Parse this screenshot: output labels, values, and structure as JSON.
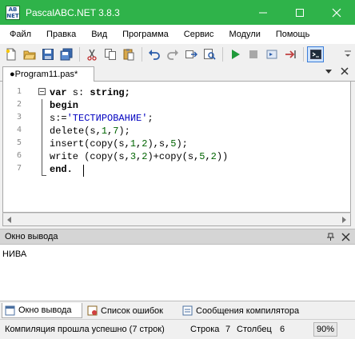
{
  "window": {
    "title": "PascalABC.NET 3.8.3",
    "icon_text": [
      "AB",
      "NET"
    ]
  },
  "menu": [
    "Файл",
    "Правка",
    "Вид",
    "Программа",
    "Сервис",
    "Модули",
    "Помощь"
  ],
  "toolbar": {
    "buttons": [
      "new-file-icon",
      "open-folder-icon",
      "save-icon",
      "save-all-icon",
      "cut-icon",
      "copy-icon",
      "paste-icon",
      "undo-icon",
      "redo-icon",
      "navigate-icon",
      "find-icon",
      "run-icon",
      "stop-icon",
      "step-icon",
      "debug-icon",
      "console-icon"
    ]
  },
  "editor": {
    "tab_label": "●Program11.pas*",
    "line_numbers": [
      "1",
      "2",
      "3",
      "4",
      "5",
      "6",
      "7"
    ],
    "lines": {
      "l1_kw": "var",
      "l1_rest": " s: ",
      "l1_type": "string;",
      "l2_kw": "begin",
      "l3_a": "s:=",
      "l3_str": "'ТЕСТИРОВАНИЕ'",
      "l3_b": ";",
      "l4_a": "delete(s,",
      "l4_n1": "1",
      "l4_b": ",",
      "l4_n2": "7",
      "l4_c": ");",
      "l5_a": "insert(copy(s,",
      "l5_n1": "1",
      "l5_b": ",",
      "l5_n2": "2",
      "l5_c": "),s,",
      "l5_n3": "5",
      "l5_d": ");",
      "l6_a": "write (copy(s,",
      "l6_n1": "3",
      "l6_b": ",",
      "l6_n2": "2",
      "l6_c": ")+copy(s,",
      "l6_n3": "5",
      "l6_d": ",",
      "l6_n4": "2",
      "l6_e": "))",
      "l7_kw": "end."
    }
  },
  "output": {
    "header": "Окно вывода",
    "text": "НИВА"
  },
  "bottom_tabs": [
    "Окно вывода",
    "Список ошибок",
    "Сообщения компилятора"
  ],
  "status": {
    "message": "Компиляция прошла успешно (7 строк)",
    "line_label": "Строка",
    "line_value": "7",
    "col_label": "Столбец",
    "col_value": "6",
    "zoom": "90%"
  },
  "colors": {
    "titlebar": "#2fb34a",
    "keyword": "#000000",
    "string": "#0000c0",
    "number": "#006400"
  }
}
